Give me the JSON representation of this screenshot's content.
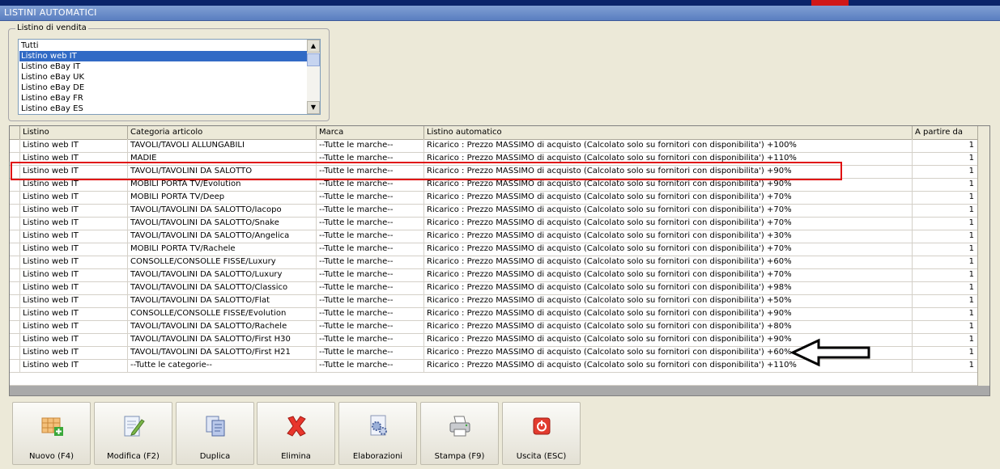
{
  "window": {
    "title": "LISTINI AUTOMATICI"
  },
  "listino_vendita": {
    "label": "Listino di vendita",
    "items": [
      "Tutti",
      "Listino web IT",
      "Listino eBay IT",
      "Listino eBay UK",
      "Listino eBay DE",
      "Listino eBay FR",
      "Listino eBay ES"
    ],
    "selected": "Listino web IT"
  },
  "grid": {
    "columns": [
      "Listino",
      "Categoria articolo",
      "Marca",
      "Listino automatico",
      "A partire da"
    ],
    "rows": [
      [
        "Listino web IT",
        "TAVOLI/TAVOLI ALLUNGABILI",
        "--Tutte le marche--",
        "Ricarico : Prezzo MASSIMO di acquisto (Calcolato solo su fornitori con disponibilita') +100%",
        "1"
      ],
      [
        "Listino web IT",
        "MADIE",
        "--Tutte le marche--",
        "Ricarico : Prezzo MASSIMO di acquisto (Calcolato solo su fornitori con disponibilita') +110%",
        "1"
      ],
      [
        "Listino web IT",
        "TAVOLI/TAVOLINI DA SALOTTO",
        "--Tutte le marche--",
        "Ricarico : Prezzo MASSIMO di acquisto (Calcolato solo su fornitori con disponibilita') +90%",
        "1"
      ],
      [
        "Listino web IT",
        "MOBILI PORTA TV/Evolution",
        "--Tutte le marche--",
        "Ricarico : Prezzo MASSIMO di acquisto (Calcolato solo su fornitori con disponibilita') +90%",
        "1"
      ],
      [
        "Listino web IT",
        "MOBILI PORTA TV/Deep",
        "--Tutte le marche--",
        "Ricarico : Prezzo MASSIMO di acquisto (Calcolato solo su fornitori con disponibilita') +70%",
        "1"
      ],
      [
        "Listino web IT",
        "TAVOLI/TAVOLINI DA SALOTTO/Iacopo",
        "--Tutte le marche--",
        "Ricarico : Prezzo MASSIMO di acquisto (Calcolato solo su fornitori con disponibilita') +70%",
        "1"
      ],
      [
        "Listino web IT",
        "TAVOLI/TAVOLINI DA SALOTTO/Snake",
        "--Tutte le marche--",
        "Ricarico : Prezzo MASSIMO di acquisto (Calcolato solo su fornitori con disponibilita') +70%",
        "1"
      ],
      [
        "Listino web IT",
        "TAVOLI/TAVOLINI DA SALOTTO/Angelica",
        "--Tutte le marche--",
        "Ricarico : Prezzo MASSIMO di acquisto (Calcolato solo su fornitori con disponibilita') +30%",
        "1"
      ],
      [
        "Listino web IT",
        "MOBILI PORTA TV/Rachele",
        "--Tutte le marche--",
        "Ricarico : Prezzo MASSIMO di acquisto (Calcolato solo su fornitori con disponibilita') +70%",
        "1"
      ],
      [
        "Listino web IT",
        "CONSOLLE/CONSOLLE FISSE/Luxury",
        "--Tutte le marche--",
        "Ricarico : Prezzo MASSIMO di acquisto (Calcolato solo su fornitori con disponibilita') +60%",
        "1"
      ],
      [
        "Listino web IT",
        "TAVOLI/TAVOLINI DA SALOTTO/Luxury",
        "--Tutte le marche--",
        "Ricarico : Prezzo MASSIMO di acquisto (Calcolato solo su fornitori con disponibilita') +70%",
        "1"
      ],
      [
        "Listino web IT",
        "TAVOLI/TAVOLINI DA SALOTTO/Classico",
        "--Tutte le marche--",
        "Ricarico : Prezzo MASSIMO di acquisto (Calcolato solo su fornitori con disponibilita') +98%",
        "1"
      ],
      [
        "Listino web IT",
        "TAVOLI/TAVOLINI DA SALOTTO/Flat",
        "--Tutte le marche--",
        "Ricarico : Prezzo MASSIMO di acquisto (Calcolato solo su fornitori con disponibilita') +50%",
        "1"
      ],
      [
        "Listino web IT",
        "CONSOLLE/CONSOLLE FISSE/Evolution",
        "--Tutte le marche--",
        "Ricarico : Prezzo MASSIMO di acquisto (Calcolato solo su fornitori con disponibilita') +90%",
        "1"
      ],
      [
        "Listino web IT",
        "TAVOLI/TAVOLINI DA SALOTTO/Rachele",
        "--Tutte le marche--",
        "Ricarico : Prezzo MASSIMO di acquisto (Calcolato solo su fornitori con disponibilita') +80%",
        "1"
      ],
      [
        "Listino web IT",
        "TAVOLI/TAVOLINI DA SALOTTO/First H30",
        "--Tutte le marche--",
        "Ricarico : Prezzo MASSIMO di acquisto (Calcolato solo su fornitori con disponibilita') +90%",
        "1"
      ],
      [
        "Listino web IT",
        "TAVOLI/TAVOLINI DA SALOTTO/First H21",
        "--Tutte le marche--",
        "Ricarico : Prezzo MASSIMO di acquisto (Calcolato solo su fornitori con disponibilita') +60%",
        "1"
      ],
      [
        "Listino web IT",
        "--Tutte le categorie--",
        "--Tutte le marche--",
        "Ricarico : Prezzo MASSIMO di acquisto (Calcolato solo su fornitori con disponibilita') +110%",
        "1"
      ]
    ]
  },
  "toolbar": [
    {
      "label": "Nuovo (F4)",
      "icon": "new-grid-icon"
    },
    {
      "label": "Modifica (F2)",
      "icon": "edit-icon"
    },
    {
      "label": "Duplica",
      "icon": "duplicate-icon"
    },
    {
      "label": "Elimina",
      "icon": "delete-icon"
    },
    {
      "label": "Elaborazioni",
      "icon": "process-icon"
    },
    {
      "label": "Stampa (F9)",
      "icon": "printer-icon"
    },
    {
      "label": "Uscita (ESC)",
      "icon": "exit-icon"
    }
  ],
  "colors": {
    "selection": "#316ac5",
    "highlight_box": "#e01010"
  }
}
